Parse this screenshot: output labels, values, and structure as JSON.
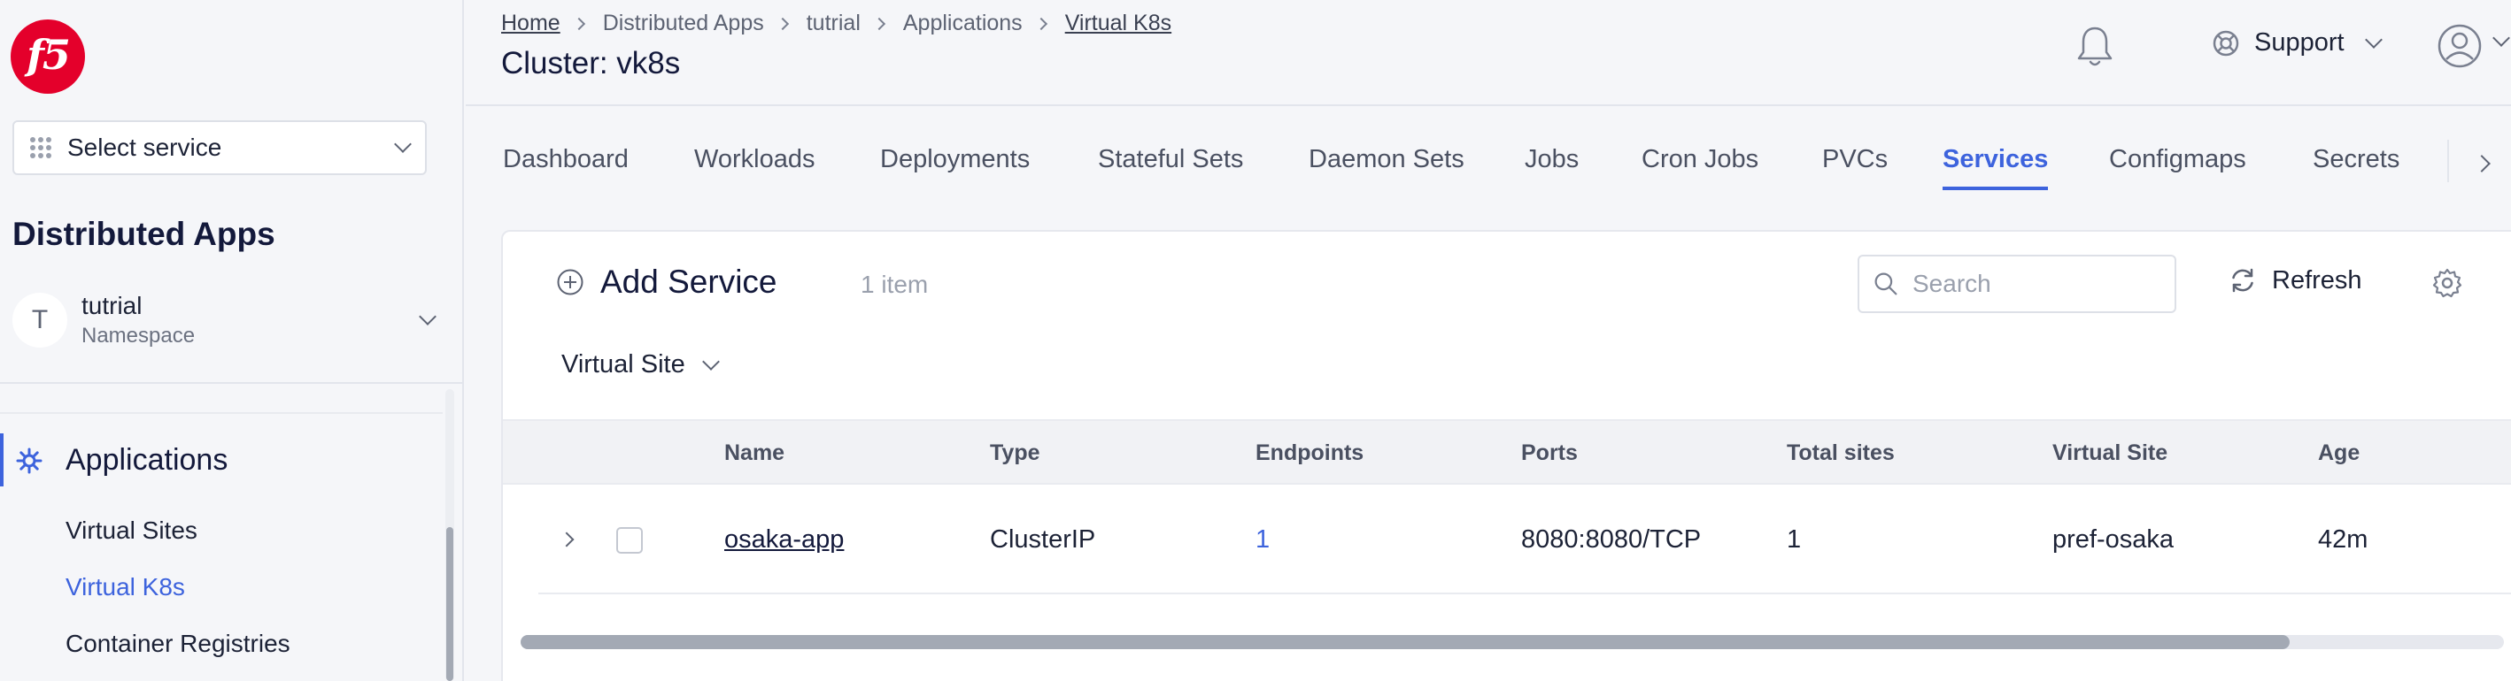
{
  "brand": {
    "logo_text": "f5",
    "logo_color": "#e4002b"
  },
  "sidebar": {
    "service_select": {
      "label": "Select service"
    },
    "title": "Distributed Apps",
    "namespace": {
      "avatar_letter": "T",
      "name": "tutrial",
      "label": "Namespace"
    },
    "group": {
      "label": "Applications",
      "icon": "kubernetes-helm-icon"
    },
    "items": [
      {
        "label": "Virtual Sites",
        "active": false
      },
      {
        "label": "Virtual K8s",
        "active": true
      },
      {
        "label": "Container Registries",
        "active": false
      }
    ]
  },
  "header": {
    "breadcrumb": [
      {
        "label": "Home",
        "link": true
      },
      {
        "label": "Distributed Apps",
        "link": false
      },
      {
        "label": "tutrial",
        "link": false
      },
      {
        "label": "Applications",
        "link": false
      },
      {
        "label": "Virtual K8s",
        "link": true
      }
    ],
    "title": "Cluster: vk8s",
    "support_label": "Support"
  },
  "tabs": [
    {
      "label": "Dashboard",
      "active": false
    },
    {
      "label": "Workloads",
      "active": false
    },
    {
      "label": "Deployments",
      "active": false
    },
    {
      "label": "Stateful Sets",
      "active": false
    },
    {
      "label": "Daemon Sets",
      "active": false
    },
    {
      "label": "Jobs",
      "active": false
    },
    {
      "label": "Cron Jobs",
      "active": false
    },
    {
      "label": "PVCs",
      "active": false
    },
    {
      "label": "Services",
      "active": true
    },
    {
      "label": "Configmaps",
      "active": false
    },
    {
      "label": "Secrets",
      "active": false
    }
  ],
  "toolbar": {
    "add_label": "Add Service",
    "item_count": "1 item",
    "search_placeholder": "Search",
    "refresh_label": "Refresh",
    "filter_label": "Virtual Site"
  },
  "table": {
    "columns": [
      "Name",
      "Type",
      "Endpoints",
      "Ports",
      "Total sites",
      "Virtual Site",
      "Age"
    ],
    "rows": [
      {
        "name": "osaka-app",
        "type": "ClusterIP",
        "endpoints": "1",
        "ports": "8080:8080/TCP",
        "total_sites": "1",
        "virtual_site": "pref-osaka",
        "age": "42m"
      }
    ]
  },
  "colors": {
    "accent": "#3d63dd",
    "text": "#1c2236",
    "muted": "#9aa0ad"
  }
}
